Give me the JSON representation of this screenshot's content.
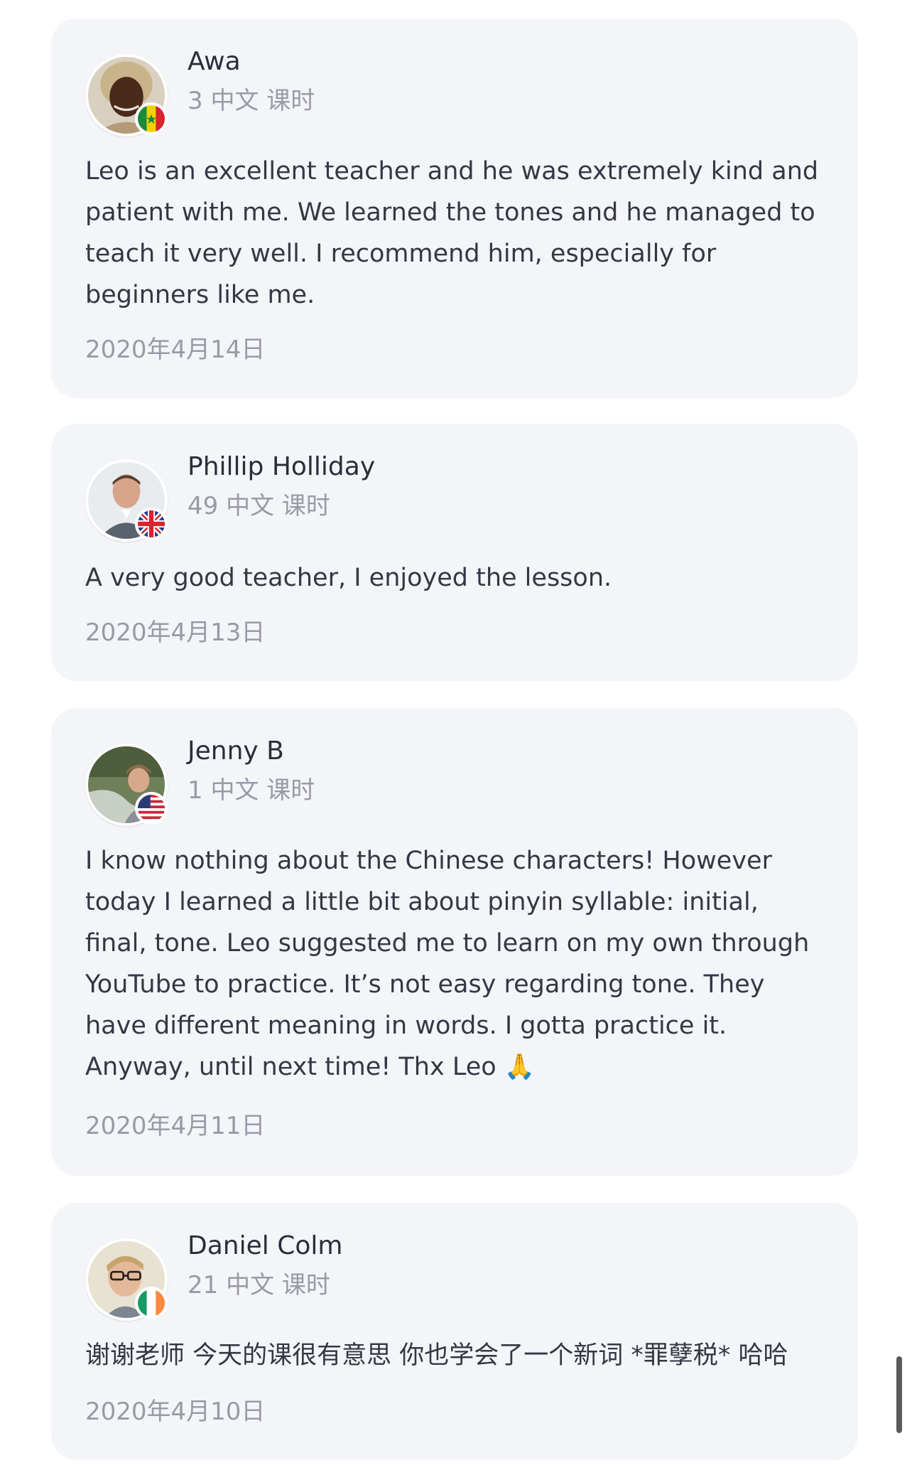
{
  "reviews": [
    {
      "name": "Awa",
      "lessons": "3 中文 课时",
      "text": "Leo is an excellent teacher and he was extremely kind and patient with me. We learned the tones and he managed to teach it very well. I recommend him, especially for beginners like me.",
      "date": "2020年4月14日",
      "flag_icon": "senegal-flag-icon"
    },
    {
      "name": "Phillip Holliday",
      "lessons": "49 中文 课时",
      "text": "A very good teacher, I enjoyed the lesson.",
      "date": "2020年4月13日",
      "flag_icon": "uk-flag-icon"
    },
    {
      "name": "Jenny B",
      "lessons": "1 中文 课时",
      "text": "I know nothing about the Chinese characters! However today I learned a little bit about pinyin syllable: initial, final, tone. Leo suggested me to learn on my own through YouTube to practice. It’s not easy regarding tone. They have different meaning in words. I gotta practice it. Anyway, until next time! Thx Leo 🙏",
      "date": "2020年4月11日",
      "flag_icon": "us-flag-icon"
    },
    {
      "name": "Daniel Colm",
      "lessons": "21 中文 课时",
      "text": "谢谢老师 今天的课很有意思 你也学会了一个新词 *罪孽税* 哈哈",
      "date": "2020年4月10日",
      "flag_icon": "ireland-flag-icon"
    }
  ],
  "colors": {
    "card_background": "#f4f5f9",
    "name_text": "#2b2d3a",
    "meta_text": "#9a9aa6",
    "body_text": "#353744"
  }
}
